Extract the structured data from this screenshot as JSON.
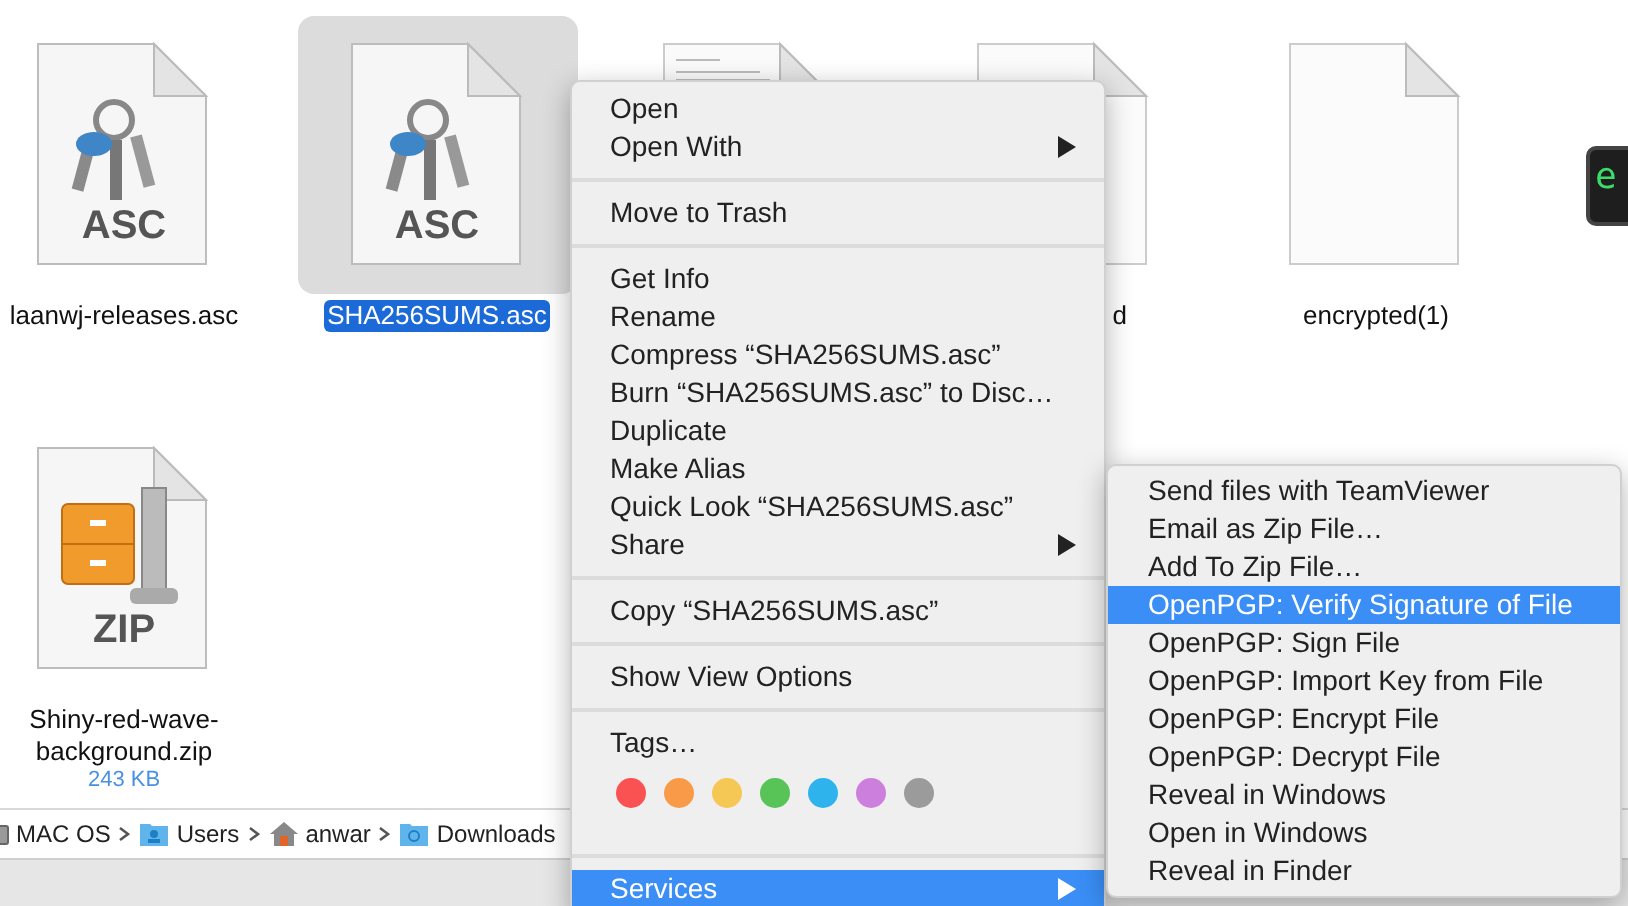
{
  "files": [
    {
      "kind": "asc",
      "icon_label": "ASC",
      "label": "laanwj-releases.asc",
      "selected": false
    },
    {
      "kind": "asc",
      "icon_label": "ASC",
      "label": "SHA256SUMS.asc",
      "selected": true
    },
    {
      "kind": "text_document",
      "selected": false
    },
    {
      "kind": "blank_covered",
      "label": "d",
      "selected": false
    },
    {
      "kind": "blank",
      "label": "encrypted(1)",
      "selected": false
    },
    {
      "kind": "terminal",
      "icon_label": "e",
      "selected": false
    },
    {
      "kind": "zip",
      "icon_label": "ZIP",
      "label": "Shiny-red-wave-background.zip",
      "size": "243 KB",
      "selected": false
    }
  ],
  "path_bar": [
    {
      "kind": "disk",
      "label": "MAC OS"
    },
    {
      "kind": "user_folder",
      "label": "Users"
    },
    {
      "kind": "home",
      "label": "anwar"
    },
    {
      "kind": "download_folder",
      "label": "Downloads"
    }
  ],
  "context_menu": [
    {
      "kind": "item",
      "label": "Open",
      "submenu": false,
      "selected": false
    },
    {
      "kind": "item",
      "label": "Open With",
      "submenu": true,
      "selected": false
    },
    {
      "kind": "separator"
    },
    {
      "kind": "item",
      "label": "Move to Trash",
      "submenu": false,
      "selected": false
    },
    {
      "kind": "separator"
    },
    {
      "kind": "item",
      "label": "Get Info",
      "submenu": false,
      "selected": false
    },
    {
      "kind": "item",
      "label": "Rename",
      "submenu": false,
      "selected": false
    },
    {
      "kind": "item",
      "label": "Compress “SHA256SUMS.asc”",
      "submenu": false,
      "selected": false
    },
    {
      "kind": "item",
      "label": "Burn “SHA256SUMS.asc” to Disc…",
      "submenu": false,
      "selected": false
    },
    {
      "kind": "item",
      "label": "Duplicate",
      "submenu": false,
      "selected": false
    },
    {
      "kind": "item",
      "label": "Make Alias",
      "submenu": false,
      "selected": false
    },
    {
      "kind": "item",
      "label": "Quick Look “SHA256SUMS.asc”",
      "submenu": false,
      "selected": false
    },
    {
      "kind": "item",
      "label": "Share",
      "submenu": true,
      "selected": false
    },
    {
      "kind": "separator"
    },
    {
      "kind": "item",
      "label": "Copy “SHA256SUMS.asc”",
      "submenu": false,
      "selected": false
    },
    {
      "kind": "separator"
    },
    {
      "kind": "item",
      "label": "Show View Options",
      "submenu": false,
      "selected": false
    },
    {
      "kind": "separator"
    },
    {
      "kind": "item",
      "label": "Tags…",
      "submenu": false,
      "selected": false
    },
    {
      "kind": "tags",
      "tags": [
        {
          "color": "#fa5252"
        },
        {
          "color": "#f99a48"
        },
        {
          "color": "#f5c755"
        },
        {
          "color": "#58c356"
        },
        {
          "color": "#2fb3ec"
        },
        {
          "color": "#cc7fdc"
        },
        {
          "color": "#9b9b9b"
        }
      ]
    },
    {
      "kind": "separator"
    },
    {
      "kind": "item",
      "label": "Services",
      "submenu": true,
      "selected": true
    }
  ],
  "services_submenu": [
    {
      "label": "Send files with TeamViewer",
      "selected": false
    },
    {
      "label": "Email as Zip File…",
      "selected": false
    },
    {
      "label": "Add To Zip File…",
      "selected": false
    },
    {
      "label": "OpenPGP: Verify Signature of File",
      "selected": true
    },
    {
      "label": "OpenPGP: Sign File",
      "selected": false
    },
    {
      "label": "OpenPGP: Import Key from File",
      "selected": false
    },
    {
      "label": "OpenPGP: Encrypt File",
      "selected": false
    },
    {
      "label": "OpenPGP: Decrypt File",
      "selected": false
    },
    {
      "label": "Reveal in Windows",
      "selected": false
    },
    {
      "label": "Open in Windows",
      "selected": false
    },
    {
      "label": "Reveal in Finder",
      "selected": false
    }
  ]
}
